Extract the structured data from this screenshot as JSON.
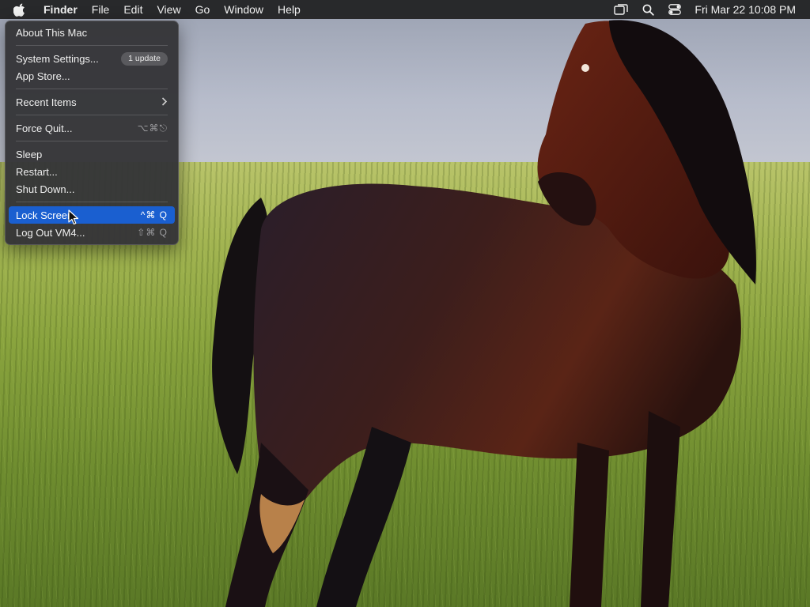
{
  "menubar": {
    "app_name": "Finder",
    "menus": [
      "File",
      "Edit",
      "View",
      "Go",
      "Window",
      "Help"
    ],
    "status_icons": [
      "screen-mirroring-icon",
      "spotlight-search-icon",
      "control-center-icon"
    ],
    "clock": "Fri Mar 22  10:08 PM"
  },
  "apple_menu": {
    "about": "About This Mac",
    "system_settings": "System Settings...",
    "system_settings_badge": "1 update",
    "app_store": "App Store...",
    "recent_items": "Recent Items",
    "force_quit": "Force Quit...",
    "force_quit_shortcut": "⌥⌘⎋",
    "sleep": "Sleep",
    "restart": "Restart...",
    "shut_down": "Shut Down...",
    "lock_screen": "Lock Screen",
    "lock_screen_shortcut": "^⌘ Q",
    "log_out": "Log Out VM4...",
    "log_out_shortcut": "⇧⌘ Q",
    "selected_item": "Lock Screen"
  },
  "colors": {
    "menubar_bg": "#1e1e20",
    "menu_bg": "#343437",
    "selection": "#1a5fd0",
    "shortcut_text": "#9b9b9e"
  }
}
